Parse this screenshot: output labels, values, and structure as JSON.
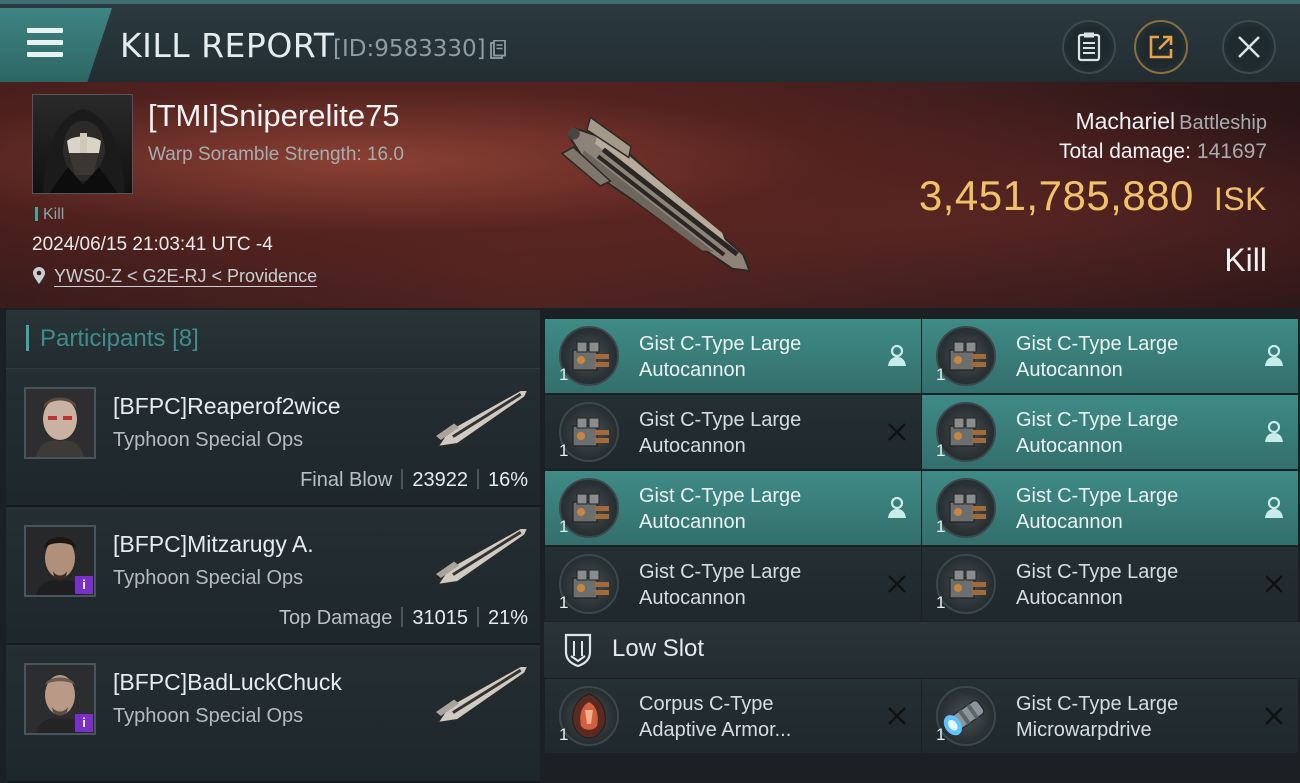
{
  "header": {
    "title": "KILL REPORT",
    "report_id": "[ID:9583330]"
  },
  "victim": {
    "name": "[TMI]Sniperelite75",
    "warp_scramble": "Warp Soramble Strength: 16.0",
    "tag": "Kill",
    "timestamp": "2024/06/15 21:03:41 UTC -4",
    "location": "YWS0-Z < G2E-RJ < Providence",
    "ship_name": "Machariel",
    "ship_class": "Battleship",
    "total_damage_label": "Total damage:",
    "total_damage": "141697",
    "isk_value": "3,451,785,880",
    "isk_unit": "ISK",
    "result": "Kill"
  },
  "participants": {
    "label": "Participants",
    "count": "[8]",
    "rows": [
      {
        "name": "[BFPC]Reaperof2wice",
        "ship": "Typhoon Special Ops",
        "role": "Final Blow",
        "damage": "23922",
        "percent": "16%"
      },
      {
        "name": "[BFPC]Mitzarugy A.",
        "ship": "Typhoon Special Ops",
        "role": "Top Damage",
        "damage": "31015",
        "percent": "21%"
      },
      {
        "name": "[BFPC]BadLuckChuck",
        "ship": "Typhoon Special Ops",
        "role": "",
        "damage": "",
        "percent": ""
      }
    ]
  },
  "modules": [
    {
      "name_line1": "Gist C-Type Large",
      "name_line2": "Autocannon",
      "qty": "1",
      "status": "dropped"
    },
    {
      "name_line1": "Gist C-Type Large",
      "name_line2": "Autocannon",
      "qty": "1",
      "status": "dropped"
    },
    {
      "name_line1": "Gist C-Type Large",
      "name_line2": "Autocannon",
      "qty": "1",
      "status": "destroyed"
    },
    {
      "name_line1": "Gist C-Type Large",
      "name_line2": "Autocannon",
      "qty": "1",
      "status": "dropped"
    },
    {
      "name_line1": "Gist C-Type Large",
      "name_line2": "Autocannon",
      "qty": "1",
      "status": "dropped"
    },
    {
      "name_line1": "Gist C-Type Large",
      "name_line2": "Autocannon",
      "qty": "1",
      "status": "dropped"
    },
    {
      "name_line1": "Gist C-Type Large",
      "name_line2": "Autocannon",
      "qty": "1",
      "status": "destroyed"
    },
    {
      "name_line1": "Gist C-Type Large",
      "name_line2": "Autocannon",
      "qty": "1",
      "status": "destroyed"
    }
  ],
  "low_slot": {
    "label": "Low Slot",
    "modules": [
      {
        "name_line1": "Corpus C-Type",
        "name_line2": "Adaptive Armor...",
        "qty": "1",
        "status": "destroyed"
      },
      {
        "name_line1": "Gist C-Type Large",
        "name_line2": "Microwarpdrive",
        "qty": "1",
        "status": "destroyed"
      }
    ]
  },
  "colors": {
    "accent_teal": "#3fa7a0",
    "dropped_bg": "#3f8b86",
    "isk_gold": "#f0c36a",
    "badge_purple": "#7a2fc9"
  }
}
